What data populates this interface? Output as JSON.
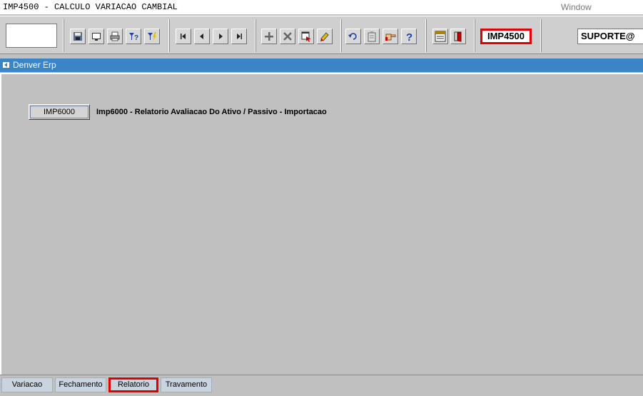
{
  "window": {
    "title": "IMP4500 - CALCULO VARIACAO CAMBIAL",
    "menu_window": "Window"
  },
  "toolbar": {
    "buttons": [
      {
        "name": "save-icon",
        "tooltip": "Save"
      },
      {
        "name": "monitor-icon",
        "tooltip": "Screen"
      },
      {
        "name": "print-icon",
        "tooltip": "Print"
      },
      {
        "name": "query-enter-icon",
        "tooltip": "Enter Query"
      },
      {
        "name": "query-execute-icon",
        "tooltip": "Execute Query"
      },
      {
        "name": "first-record-icon",
        "tooltip": "First"
      },
      {
        "name": "previous-record-icon",
        "tooltip": "Previous"
      },
      {
        "name": "next-record-icon",
        "tooltip": "Next"
      },
      {
        "name": "last-record-icon",
        "tooltip": "Last"
      },
      {
        "name": "insert-record-icon",
        "tooltip": "Insert"
      },
      {
        "name": "delete-record-icon",
        "tooltip": "Delete"
      },
      {
        "name": "lov-icon",
        "tooltip": "List of Values"
      },
      {
        "name": "edit-icon",
        "tooltip": "Edit"
      },
      {
        "name": "undo-icon",
        "tooltip": "Undo"
      },
      {
        "name": "clipboard-icon",
        "tooltip": "Clipboard"
      },
      {
        "name": "pointing-hand-icon",
        "tooltip": "Go"
      },
      {
        "name": "help-icon",
        "tooltip": "Help"
      },
      {
        "name": "menu-icon",
        "tooltip": "Menu"
      },
      {
        "name": "exit-icon",
        "tooltip": "Exit"
      }
    ],
    "form_code": "IMP4500",
    "user": "SUPORTE@"
  },
  "frame": {
    "title": "Denver Erp"
  },
  "main": {
    "report_button_label": "IMP6000",
    "report_description": "Imp6000 - Relatorio Avaliacao Do Ativo / Passivo - Importacao"
  },
  "tabs": [
    {
      "label": "Variacao",
      "active": false
    },
    {
      "label": "Fechamento",
      "active": false
    },
    {
      "label": "Relatorio",
      "active": true
    },
    {
      "label": "Travamento",
      "active": false
    }
  ],
  "colors": {
    "frame_title_bg": "#3a84c8",
    "highlight": "#e00000",
    "background": "#c0c0c0"
  }
}
